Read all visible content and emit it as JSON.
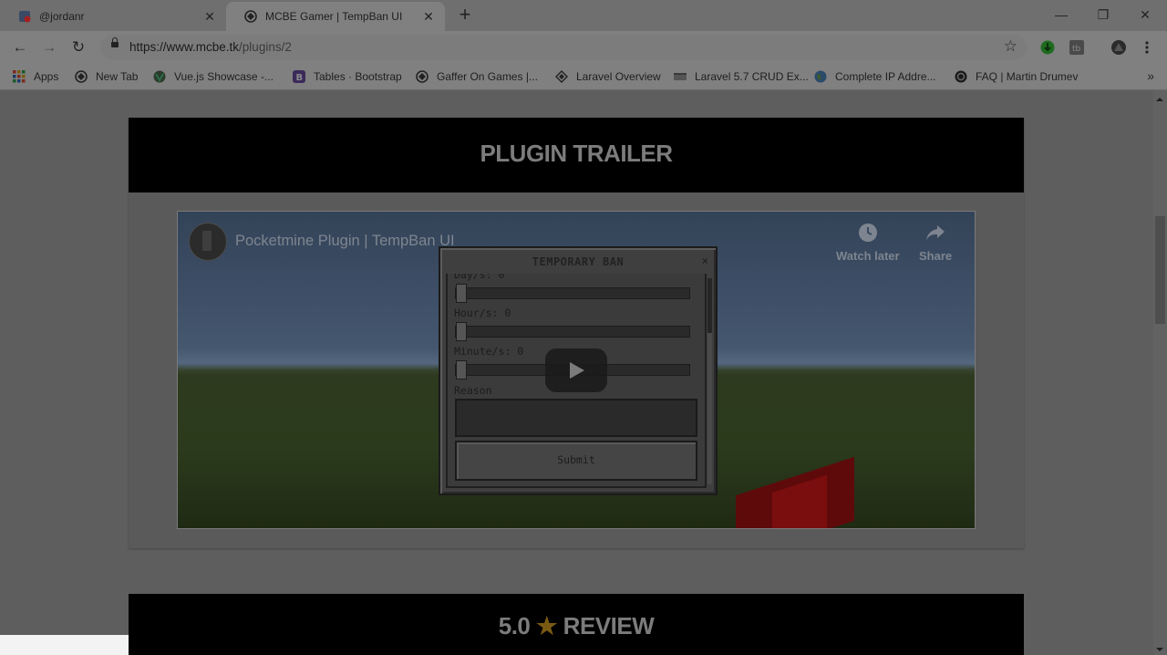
{
  "tabs": [
    {
      "title": "@jordanr",
      "close": "✕"
    },
    {
      "title": "MCBE Gamer | TempBan UI",
      "close": "✕"
    }
  ],
  "new_tab_symbol": "+",
  "window_controls": {
    "minimize": "—",
    "restore": "❐",
    "close": "✕"
  },
  "toolbar": {
    "back": "←",
    "forward": "→",
    "reload": "↻",
    "url_host": "https://www.mcbe.tk",
    "url_path": "/plugins/2",
    "bookmark_star": "☆"
  },
  "bookmarks": [
    {
      "label": "Apps",
      "icon": "apps-grid-icon"
    },
    {
      "label": "New Tab",
      "icon": "globe-icon"
    },
    {
      "label": "Vue.js Showcase -...",
      "icon": "vue-icon"
    },
    {
      "label": "Tables · Bootstrap",
      "icon": "bootstrap-icon"
    },
    {
      "label": "Gaffer On Games |...",
      "icon": "globe-icon"
    },
    {
      "label": "Laravel Overview",
      "icon": "laravel-icon"
    },
    {
      "label": "Laravel 5.7 CRUD Ex...",
      "icon": "page-icon"
    },
    {
      "label": "Complete IP Addre...",
      "icon": "earth-icon"
    },
    {
      "label": "FAQ | Martin Drumev",
      "icon": "faq-icon"
    }
  ],
  "bookmarks_overflow": "»",
  "page": {
    "trailer_heading": "PLUGIN TRAILER",
    "video": {
      "title": "Pocketmine Plugin | TempBan UI",
      "watch_later": "Watch later",
      "share": "Share"
    },
    "mc_form": {
      "title": "TEMPORARY BAN",
      "close": "×",
      "day_label": "Day/s: 0",
      "hour_label": "Hour/s: 0",
      "minute_label": "Minute/s: 0",
      "day_value": 0,
      "hour_value": 0,
      "minute_value": 0,
      "reason_label": "Reason",
      "submit_label": "Submit"
    },
    "review": {
      "score": "5.0",
      "star": "★",
      "label": "REVIEW"
    }
  }
}
